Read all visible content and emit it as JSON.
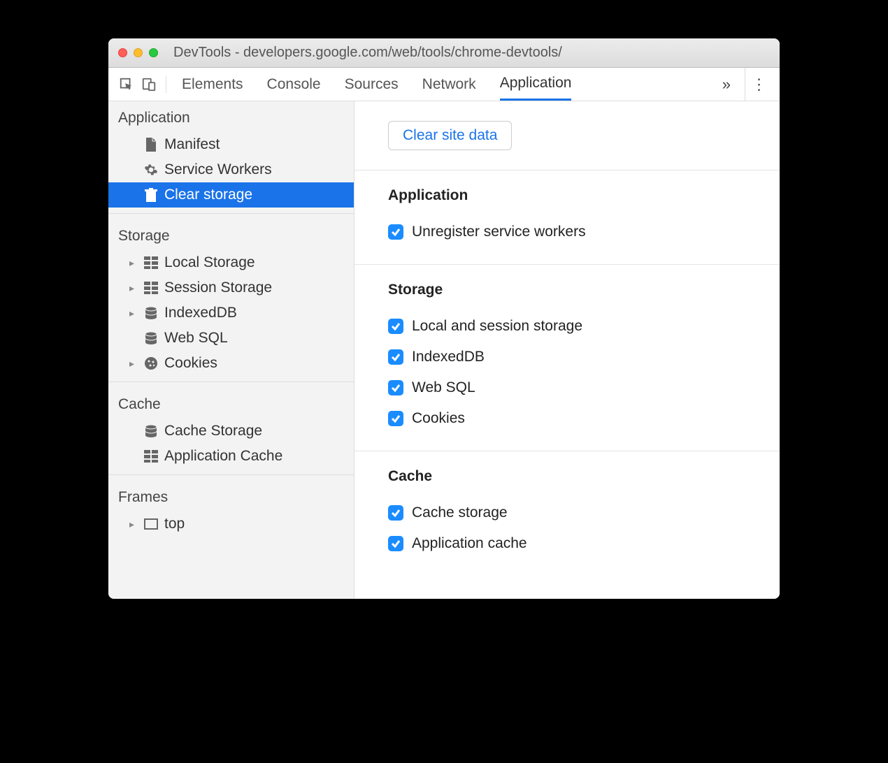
{
  "window": {
    "title": "DevTools - developers.google.com/web/tools/chrome-devtools/"
  },
  "tabs": {
    "items": [
      "Elements",
      "Console",
      "Sources",
      "Network",
      "Application"
    ],
    "active": "Application"
  },
  "sidebar": {
    "sections": [
      {
        "title": "Application",
        "items": [
          {
            "icon": "file",
            "label": "Manifest",
            "arrow": false
          },
          {
            "icon": "gear",
            "label": "Service Workers",
            "arrow": false
          },
          {
            "icon": "trash",
            "label": "Clear storage",
            "arrow": false,
            "selected": true
          }
        ]
      },
      {
        "title": "Storage",
        "items": [
          {
            "icon": "grid",
            "label": "Local Storage",
            "arrow": true
          },
          {
            "icon": "grid",
            "label": "Session Storage",
            "arrow": true
          },
          {
            "icon": "db",
            "label": "IndexedDB",
            "arrow": true
          },
          {
            "icon": "db",
            "label": "Web SQL",
            "arrow": false
          },
          {
            "icon": "cookie",
            "label": "Cookies",
            "arrow": true
          }
        ]
      },
      {
        "title": "Cache",
        "items": [
          {
            "icon": "db",
            "label": "Cache Storage",
            "arrow": false
          },
          {
            "icon": "grid",
            "label": "Application Cache",
            "arrow": false
          }
        ]
      },
      {
        "title": "Frames",
        "items": [
          {
            "icon": "frame",
            "label": "top",
            "arrow": true
          }
        ]
      }
    ]
  },
  "main": {
    "clear_button": "Clear site data",
    "groups": [
      {
        "title": "Application",
        "checks": [
          {
            "label": "Unregister service workers",
            "checked": true
          }
        ]
      },
      {
        "title": "Storage",
        "checks": [
          {
            "label": "Local and session storage",
            "checked": true
          },
          {
            "label": "IndexedDB",
            "checked": true
          },
          {
            "label": "Web SQL",
            "checked": true
          },
          {
            "label": "Cookies",
            "checked": true
          }
        ]
      },
      {
        "title": "Cache",
        "checks": [
          {
            "label": "Cache storage",
            "checked": true
          },
          {
            "label": "Application cache",
            "checked": true
          }
        ]
      }
    ]
  }
}
